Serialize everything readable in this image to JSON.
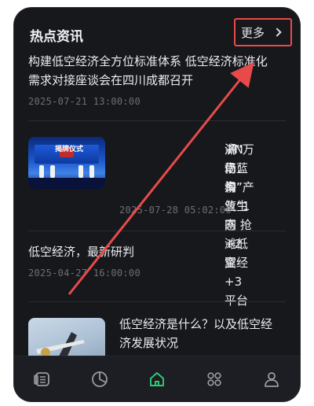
{
  "section": {
    "title": "热点资讯",
    "more_label": "更多"
  },
  "news": [
    {
      "title_line1": "构建低空经济全方位标准体系 低空经济标准化",
      "title_line2": "需求对接座谈会在四川成都召开",
      "time": "2025-07-21 13:00:00"
    },
    {
      "title_line1": "湖南：构筑“1网+2翼+3平台",
      "title_line2": "+N场景”产业生态 抢滩低空经",
      "title_line3": "济“万亿蓝海”",
      "time": "2025-07-28 05:02:08",
      "thumb_caption": "揭牌仪式"
    },
    {
      "title_line1": "低空经济，最新研判",
      "time": "2025-04-27 16:00:00"
    },
    {
      "title_line1": "低空经济是什么？以及低空经",
      "title_line2": "济发展状况"
    }
  ],
  "tabbar": {
    "items": [
      {
        "icon": "news-icon",
        "active": false
      },
      {
        "icon": "pie-chart-icon",
        "active": false
      },
      {
        "icon": "home-icon",
        "active": true
      },
      {
        "icon": "grid-icon",
        "active": false
      },
      {
        "icon": "profile-icon",
        "active": false
      }
    ]
  },
  "colors": {
    "background": "#17181c",
    "accent_active": "#2ecc71",
    "annotation_red": "#e84a4a"
  }
}
